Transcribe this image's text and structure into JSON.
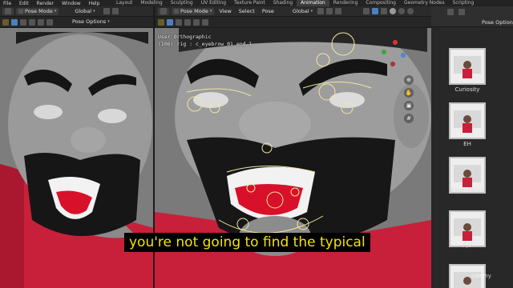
{
  "menu": [
    "File",
    "Edit",
    "Render",
    "Window",
    "Help"
  ],
  "workspace_tabs": [
    {
      "label": "Layout",
      "active": false
    },
    {
      "label": "Modeling",
      "active": false
    },
    {
      "label": "Sculpting",
      "active": false
    },
    {
      "label": "UV Editing",
      "active": false
    },
    {
      "label": "Texture Paint",
      "active": false
    },
    {
      "label": "Shading",
      "active": false
    },
    {
      "label": "Animation",
      "active": true
    },
    {
      "label": "Rendering",
      "active": false
    },
    {
      "label": "Compositing",
      "active": false
    },
    {
      "label": "Geometry Nodes",
      "active": false
    },
    {
      "label": "Scripting",
      "active": false
    }
  ],
  "left_viewport": {
    "mode": "Pose Mode",
    "transform_orientation": "Global",
    "pose_options": "Pose Options"
  },
  "center_viewport": {
    "mode": "Pose Mode",
    "menus": [
      "View",
      "Select",
      "Pose"
    ],
    "transform_orientation": "Global",
    "view_label": "User Orthographic",
    "object_label": "(106) rig : c_eyebrow_01_end.l"
  },
  "sidebar": {
    "pose_options": "Pose Options",
    "poses": [
      "Curiosity",
      "EH",
      "Expectation",
      "F,V",
      ""
    ]
  },
  "subtitle": "you're not going to find the typical",
  "watermark": "Udemy",
  "colors": {
    "skin": "#8c8c8c",
    "shirt": "#c8203a",
    "tongue": "#d8102a",
    "rig_lines": "#f1e6a0",
    "subtitle_text": "#f4e400",
    "active_tab": "#3d3d3d"
  }
}
